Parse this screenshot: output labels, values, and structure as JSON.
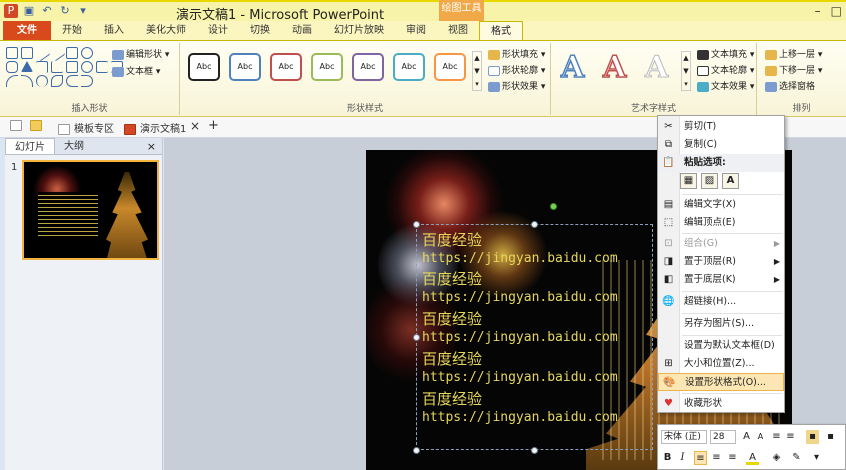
{
  "window": {
    "title": "演示文稿1 - Microsoft PowerPoint",
    "context_tab": "绘图工具"
  },
  "tabs": [
    {
      "label": "文件"
    },
    {
      "label": "开始"
    },
    {
      "label": "插入"
    },
    {
      "label": "美化大师"
    },
    {
      "label": "设计"
    },
    {
      "label": "切换"
    },
    {
      "label": "动画"
    },
    {
      "label": "幻灯片放映"
    },
    {
      "label": "审阅"
    },
    {
      "label": "视图"
    },
    {
      "label": "格式"
    }
  ],
  "ribbon": {
    "insert_shapes": {
      "label": "插入形状",
      "edit_shape": "编辑形状",
      "text_box": "文本框"
    },
    "shape_styles": {
      "label": "形状样式",
      "preset_text": "Abc",
      "preset_colors": [
        "#222222",
        "#4f81bd",
        "#c0504d",
        "#9bbb59",
        "#8064a2",
        "#4bacc6",
        "#f79646"
      ],
      "fill": "形状填充",
      "outline": "形状轮廓",
      "effects": "形状效果"
    },
    "wordart": {
      "label": "艺术字样式",
      "glyph": "A",
      "text_fill": "文本填充",
      "text_outline": "文本轮廓",
      "text_effects": "文本效果"
    },
    "arrange": {
      "label": "排列",
      "bring_forward": "上移一层",
      "send_backward": "下移一层",
      "selection_pane": "选择窗格"
    }
  },
  "docbar": {
    "template_zone": "模板专区",
    "doc_tab": "演示文稿1",
    "close": "×",
    "add": "+"
  },
  "left_panel": {
    "tabs": [
      "幻灯片",
      "大纲"
    ],
    "close": "×",
    "slide_number": "1"
  },
  "slide": {
    "lines": [
      {
        "cn": "百度经验",
        "url": "https://jingyan.baidu.com"
      },
      {
        "cn": "百度经验",
        "url": "https://jingyan.baidu.com"
      },
      {
        "cn": "百度经验",
        "url": "https://jingyan.baidu.com"
      },
      {
        "cn": "百度经验",
        "url": "https://jingyan.baidu.com"
      },
      {
        "cn": "百度经验",
        "url": "https://jingyan.baidu.com"
      }
    ],
    "text_color": "#e6d75a"
  },
  "context_menu": {
    "cut": "剪切(T)",
    "copy": "复制(C)",
    "paste_options": "粘贴选项:",
    "paste_keep_text": "A",
    "edit_text": "编辑文字(X)",
    "edit_points": "编辑顶点(E)",
    "group": "组合(G)",
    "bring_to_front": "置于顶层(R)",
    "send_to_back": "置于底层(K)",
    "hyperlink": "超链接(H)...",
    "save_as_picture": "另存为图片(S)...",
    "set_default_textbox": "设置为默认文本框(D)",
    "size_position": "大小和位置(Z)...",
    "format_shape": "设置形状格式(O)...",
    "collect_shape": "收藏形状"
  },
  "mini_toolbar": {
    "font": "宋体 (正)",
    "size": "28",
    "bold": "B",
    "italic": "I",
    "font_color": "A"
  }
}
